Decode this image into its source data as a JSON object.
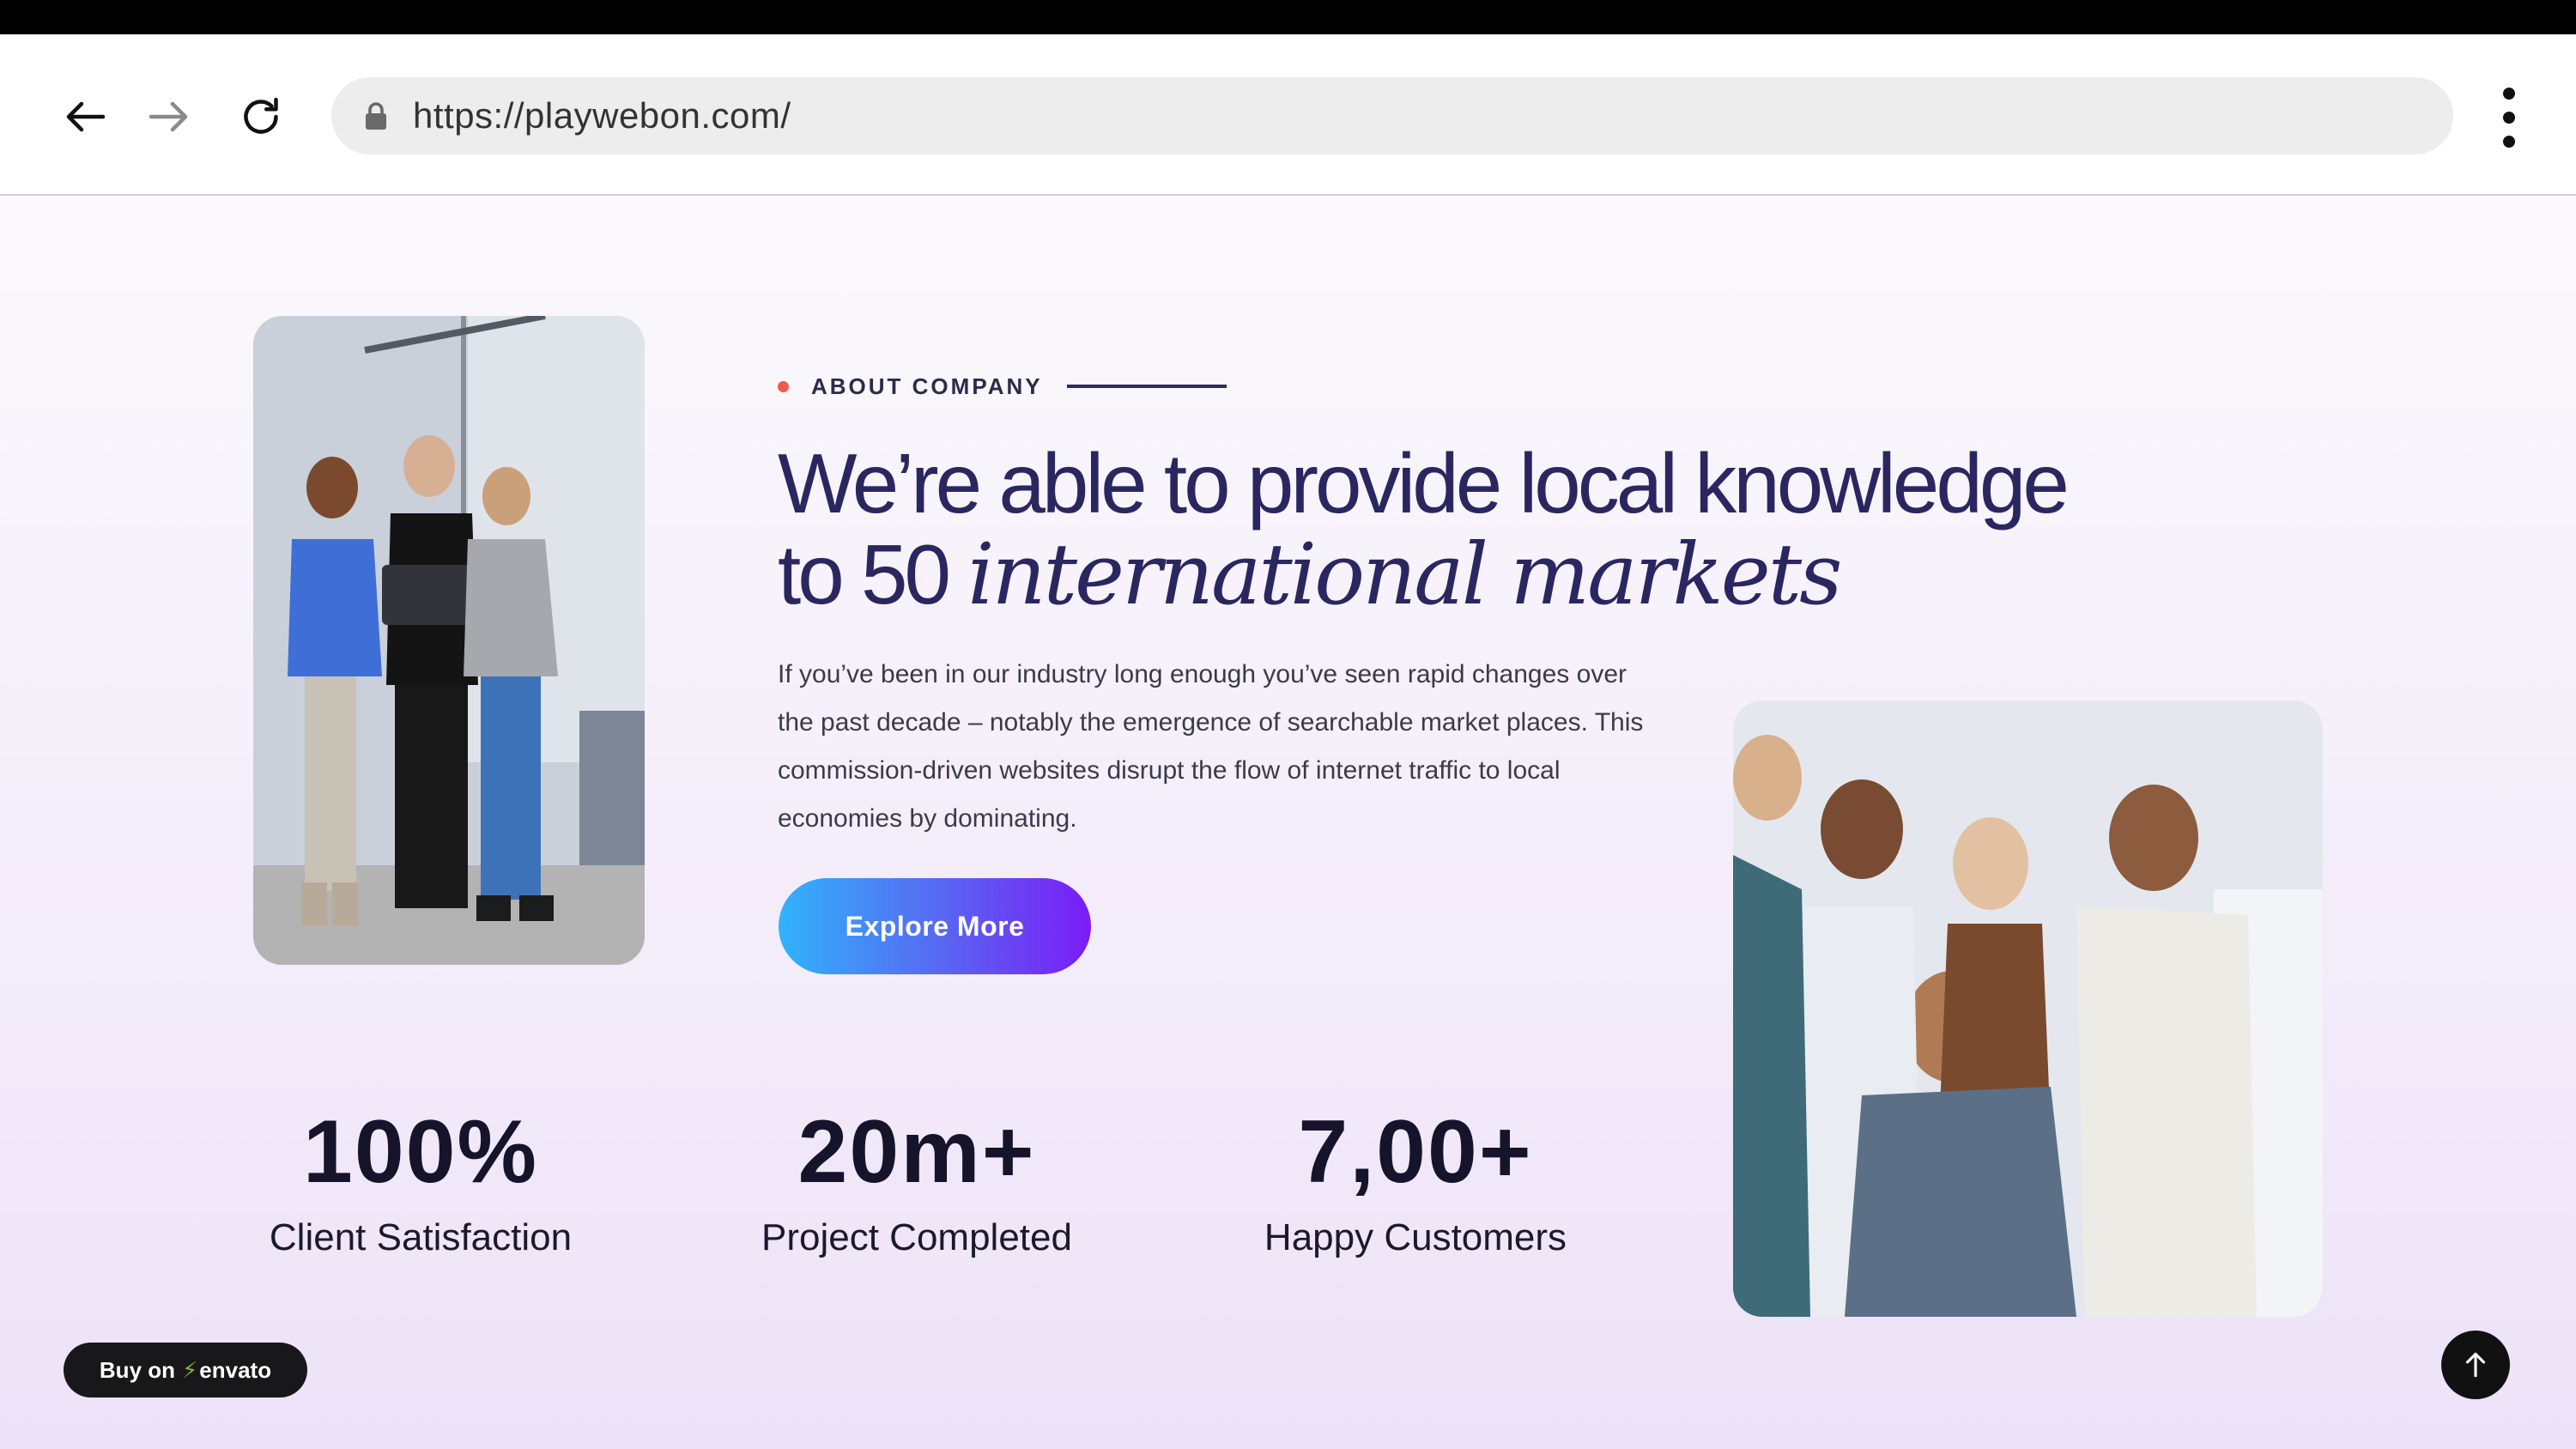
{
  "browser": {
    "url": "https://playwebon.com/"
  },
  "about": {
    "eyebrow": "ABOUT COMPANY",
    "headline_line1": "We’re able to provide local knowledge",
    "headline_line2_plain": "to 50 ",
    "headline_line2_italic": "international markets",
    "paragraph": "If you’ve been in our industry long enough you’ve seen rapid changes over the past decade – notably the emergence of searchable market places. This commission-driven websites disrupt the flow of internet traffic to local economies by dominating.",
    "cta_label": "Explore More"
  },
  "stats": [
    {
      "value": "100%",
      "label": "Client Satisfaction"
    },
    {
      "value": "20m+",
      "label": "Project Completed"
    },
    {
      "value": "7,00+",
      "label": "Happy Customers"
    }
  ],
  "badge": {
    "prefix": "Buy on",
    "brand": "envato"
  },
  "colors": {
    "accent_dot": "#ef5c49",
    "headline": "#2a2760",
    "button_start": "#31b3fb",
    "button_end": "#7a1cf7"
  }
}
